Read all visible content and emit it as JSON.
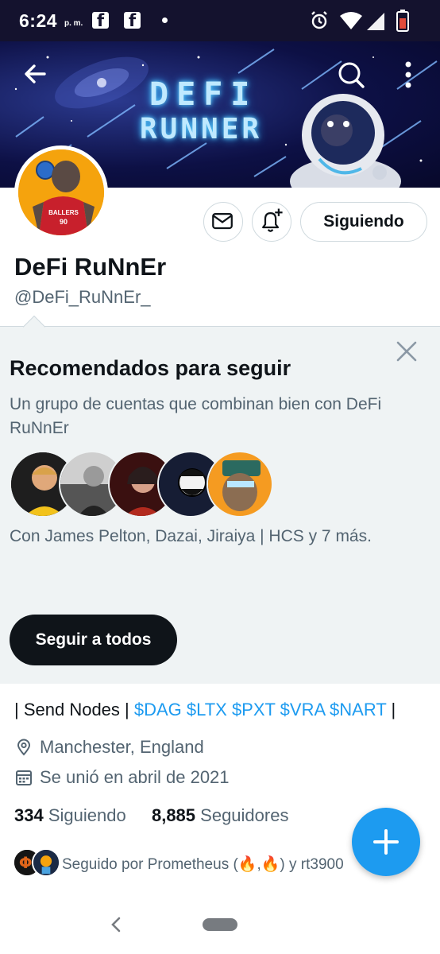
{
  "status_bar": {
    "time": "6:24",
    "ampm": "p. m."
  },
  "banner": {
    "title_line1": "DEFI",
    "title_line2": "RUNNER"
  },
  "profile": {
    "display_name": "DeFi RuNnEr",
    "handle": "@DeFi_RuNnEr_",
    "following_button": "Siguiendo",
    "avatar_jersey_text": "BALLERS",
    "avatar_jersey_number": "90"
  },
  "recommendations": {
    "title": "Recomendados para seguir",
    "description": "Un grupo de cuentas que combinan bien con DeFi RuNnEr",
    "with_text": "Con James Pelton, Dazai, Jiraiya | HCS y 7 más.",
    "follow_all": "Seguir a todos"
  },
  "bio": {
    "prefix": "| Send Nodes | ",
    "cashtags": "$DAG $LTX $PXT $VRA $NART",
    "suffix": " |",
    "location": "Manchester, England",
    "joined": "Se unió en abril de 2021"
  },
  "counts": {
    "following_count": "334",
    "following_label": "Siguiendo",
    "followers_count": "8,885",
    "followers_label": "Seguidores"
  },
  "followed_by": {
    "text_start": "Seguido por Prometheus (",
    "text_mid": ",",
    "text_end": ") y rt3900"
  },
  "colors": {
    "accent": "#1d9bf0",
    "secondary_text": "#536471",
    "reco_background": "#eff3f4"
  }
}
